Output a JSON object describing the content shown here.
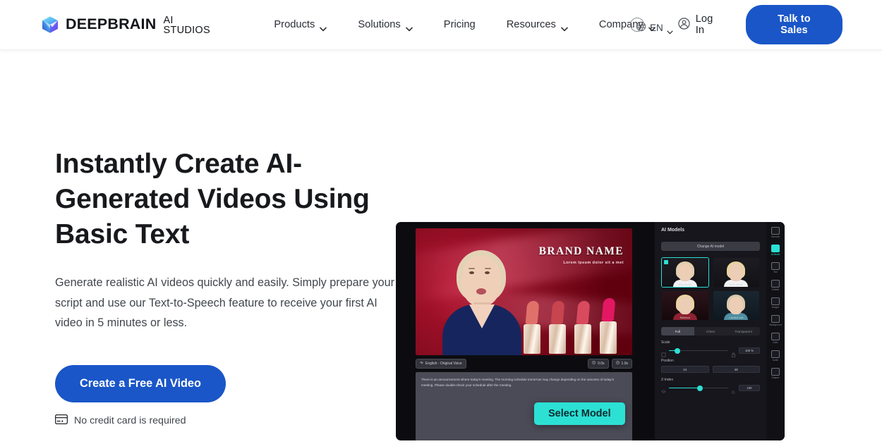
{
  "header": {
    "logo_icon": "cube-logo-icon",
    "brand_name": "DEEPBRAIN",
    "brand_sub": "AI STUDIOS",
    "nav": [
      {
        "label": "Products",
        "has_chevron": true
      },
      {
        "label": "Solutions",
        "has_chevron": true
      },
      {
        "label": "Pricing",
        "has_chevron": false
      },
      {
        "label": "Resources",
        "has_chevron": true
      },
      {
        "label": "Company",
        "has_chevron": true
      }
    ],
    "language": {
      "label": "EN",
      "icon": "globe-icon"
    },
    "login": {
      "label": "Log In",
      "icon": "user-circle-icon"
    },
    "cta": {
      "label": "Talk to Sales",
      "color": "#1a56c8"
    }
  },
  "hero": {
    "title": "Instantly Create AI-Generated Videos Using Basic Text",
    "description": "Generate realistic AI videos quickly and easily. Simply prepare your script and use our Text-to-Speech feature to receive your first AI video in 5 minutes or less.",
    "cta_label": "Create a Free AI Video",
    "cta_color": "#1a56c8",
    "note": {
      "icon": "credit-card-icon",
      "label": "No credit card is required"
    }
  },
  "mockup": {
    "video": {
      "brand_title": "BRAND NAME",
      "brand_subtitle": "Lorem Ipsum dolor sit a met"
    },
    "toolbar": {
      "language_chip": "English - Original Voice",
      "chip_icon": "voice-icon",
      "duration_chip": "0.0s",
      "duration_icon": "clock-icon",
      "total_chip": "1.0s",
      "total_icon": "clock-icon"
    },
    "script": "There is an announcement where today's meeting. The morning schedule tomorrow may change depending on the outcome of today's meeting. Please double-check your schedule after the meeting.",
    "select_model_button": {
      "label": "Select Model",
      "color": "#2ce0d4"
    },
    "panel": {
      "title": "AI Models",
      "change_button": "Change AI model",
      "models": [
        {
          "name": "Mina Studio",
          "selected": true
        },
        {
          "name": "Jenn Studio",
          "selected": false
        },
        {
          "name": "Rebecca",
          "selected": false
        },
        {
          "name": "Caroline soft",
          "selected": false
        }
      ],
      "segments": [
        {
          "label": "Full",
          "active": true
        },
        {
          "label": "Chest",
          "active": false
        },
        {
          "label": "Transparent",
          "active": false
        }
      ],
      "controls": [
        {
          "label": "Scale",
          "value": "100 %",
          "fill_pct": 14
        },
        {
          "label": "Position",
          "x": "24",
          "y": "48"
        },
        {
          "label": "Z-Index",
          "value": "100",
          "fill_pct": 52
        }
      ]
    },
    "rail": [
      {
        "label": "Scenario",
        "active": false
      },
      {
        "label": "AI Model",
        "active": true
      },
      {
        "label": "Text",
        "active": false
      },
      {
        "label": "Subtitle",
        "active": false
      },
      {
        "label": "Images",
        "active": false
      },
      {
        "label": "Background",
        "active": false
      },
      {
        "label": "Video",
        "active": false
      },
      {
        "label": "Audio",
        "active": false
      },
      {
        "label": "Shapes",
        "active": false
      }
    ]
  }
}
